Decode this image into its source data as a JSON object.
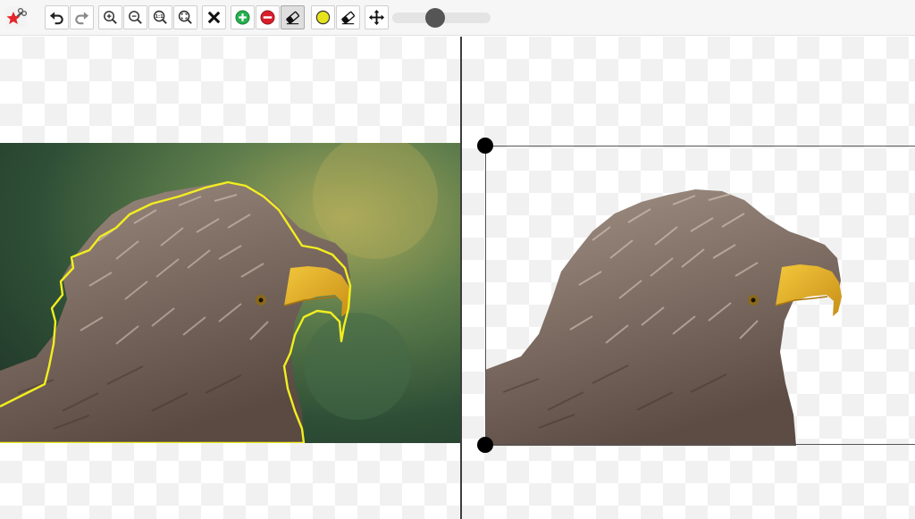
{
  "app": {
    "logo_icon": "scissors-star-logo-icon"
  },
  "toolbar": {
    "buttons": [
      {
        "name": "undo-button",
        "icon": "undo-arrow-icon"
      },
      {
        "name": "redo-button",
        "icon": "redo-arrow-icon"
      },
      {
        "name": "zoom-in-button",
        "icon": "zoom-in-icon"
      },
      {
        "name": "zoom-out-button",
        "icon": "zoom-out-icon"
      },
      {
        "name": "zoom-actual-size-button",
        "icon": "zoom-1-1-icon",
        "label": "1:1"
      },
      {
        "name": "zoom-fit-button",
        "icon": "zoom-fit-icon"
      },
      {
        "name": "clear-button",
        "icon": "close-x-icon"
      },
      {
        "name": "keep-marker-button",
        "icon": "green-plus-icon"
      },
      {
        "name": "remove-marker-button",
        "icon": "red-minus-icon"
      },
      {
        "name": "eraser-button",
        "icon": "eraser-icon",
        "state": "active"
      },
      {
        "name": "highlight-color-button",
        "icon": "yellow-circle-icon"
      },
      {
        "name": "eraser-alt-button",
        "icon": "eraser-icon"
      },
      {
        "name": "pan-button",
        "icon": "move-arrows-icon"
      }
    ],
    "brush_size_slider": {
      "value_fraction": 0.34
    }
  },
  "colors": {
    "toolbar_bg": "#f6f6f6",
    "add_green": "#22b14c",
    "remove_red": "#d81e2a",
    "highlight_yellow": "#e6e31e",
    "selection_outline": "#f2ee20",
    "divider": "#3d3d3d"
  },
  "left_canvas": {
    "content": "eagle-photo-with-selection-outline"
  },
  "right_canvas": {
    "content": "eagle-cutout-preview",
    "crop_handles": [
      "top-left",
      "bottom-left"
    ]
  }
}
